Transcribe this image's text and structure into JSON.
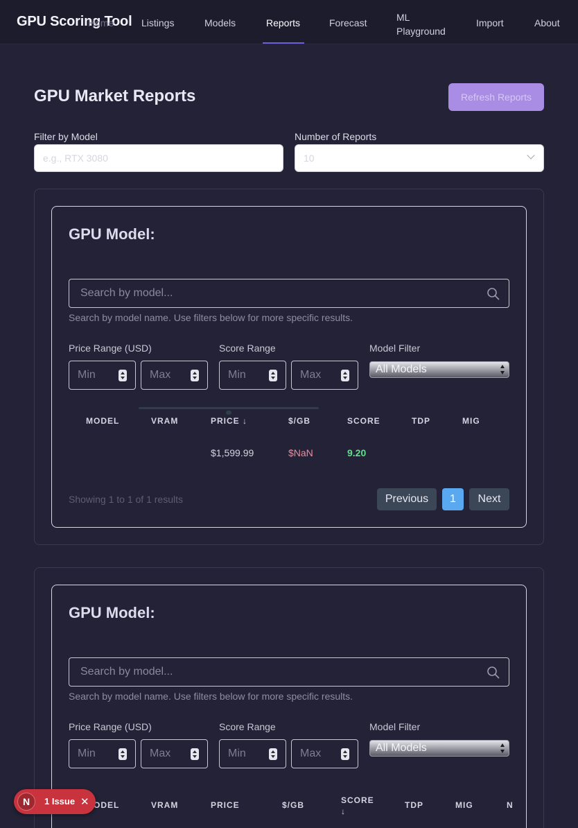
{
  "nav": {
    "brand": "GPU Scoring Tool",
    "items": [
      {
        "label": "Home"
      },
      {
        "label": "Listings"
      },
      {
        "label": "Models"
      },
      {
        "label": "Reports",
        "active": true
      },
      {
        "label": "Forecast"
      },
      {
        "label": "ML Playground"
      },
      {
        "label": "Import"
      },
      {
        "label": "About"
      }
    ]
  },
  "header": {
    "title": "GPU Market Reports",
    "refresh_label": "Refresh Reports"
  },
  "filters": {
    "model_label": "Filter by Model",
    "model_placeholder": "e.g., RTX 3080",
    "count_label": "Number of Reports",
    "count_value": "10"
  },
  "reports": [
    {
      "title": "GPU Model:",
      "search_placeholder": "Search by model...",
      "help": "Search by model name. Use filters below for more specific results.",
      "price_label": "Price Range (USD)",
      "score_label": "Score Range",
      "model_filter_label": "Model Filter",
      "min_placeholder": "Min",
      "max_placeholder": "Max",
      "model_filter_value": "All Models",
      "columns": [
        "MODEL",
        "VRAM",
        "PRICE ↓",
        "$/GB",
        "SCORE",
        "TDP",
        "MIG"
      ],
      "rows": [
        {
          "model": "",
          "vram": "",
          "price": "$1,599.99",
          "per_gb": "$NaN",
          "score": "9.20",
          "tdp": "",
          "mig": ""
        }
      ],
      "showing": "Showing 1 to 1 of 1 results",
      "pagination": {
        "prev": "Previous",
        "page": "1",
        "next": "Next"
      }
    },
    {
      "title": "GPU Model:",
      "search_placeholder": "Search by model...",
      "help": "Search by model name. Use filters below for more specific results.",
      "price_label": "Price Range (USD)",
      "score_label": "Score Range",
      "model_filter_label": "Model Filter",
      "min_placeholder": "Min",
      "max_placeholder": "Max",
      "model_filter_value": "All Models",
      "columns": [
        "MODEL",
        "VRAM",
        "PRICE",
        "$/GB",
        "SCORE ↓",
        "TDP",
        "MIG",
        "N"
      ]
    }
  ],
  "issues": {
    "badge": "N",
    "label": "1 Issue"
  },
  "colors": {
    "accent": "#6a5fd8",
    "price_per_gb": "#f08a9a",
    "score": "#5ee08a",
    "page_active": "#5aa8f0"
  }
}
